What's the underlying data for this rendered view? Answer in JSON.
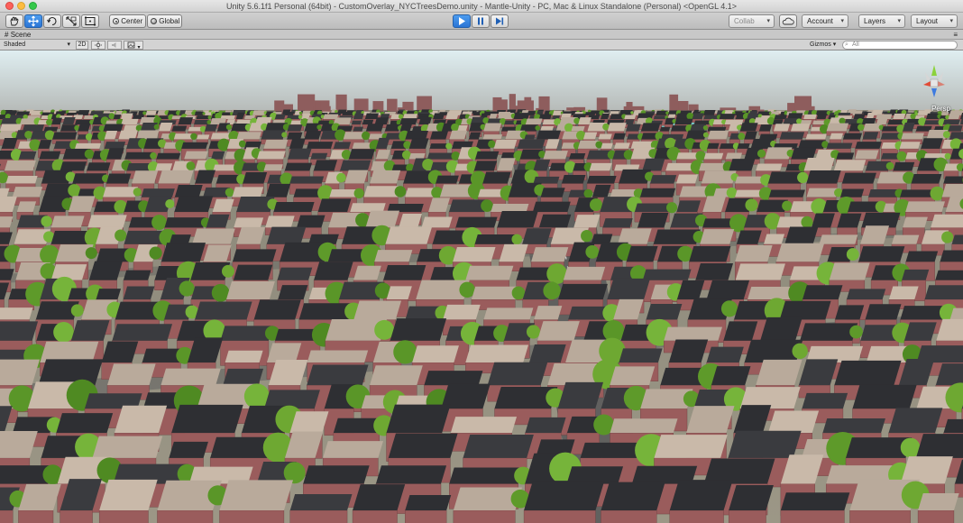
{
  "window": {
    "title": "Unity 5.6.1f1 Personal (64bit) - CustomOverlay_NYCTreesDemo.unity - Mantle-Unity - PC, Mac & Linux Standalone (Personal) <OpenGL 4.1>"
  },
  "toolbar": {
    "pivot_label": "Center",
    "space_label": "Global",
    "collab_label": "Collab",
    "account_label": "Account",
    "layers_label": "Layers",
    "layout_label": "Layout"
  },
  "scene": {
    "tab_label": "Scene",
    "shading_mode": "Shaded",
    "mode_2d_label": "2D",
    "gizmos_label": "Gizmos",
    "search_placeholder": "All",
    "projection_label": "Persp"
  },
  "colors": {
    "play_active": "#2a74d4",
    "sky": "#e9f2f3",
    "tree_green": "#5e9a2a",
    "brick": "#9a5c5c",
    "roof_dark": "#2e2f33",
    "roof_light": "#c9b9a9"
  }
}
